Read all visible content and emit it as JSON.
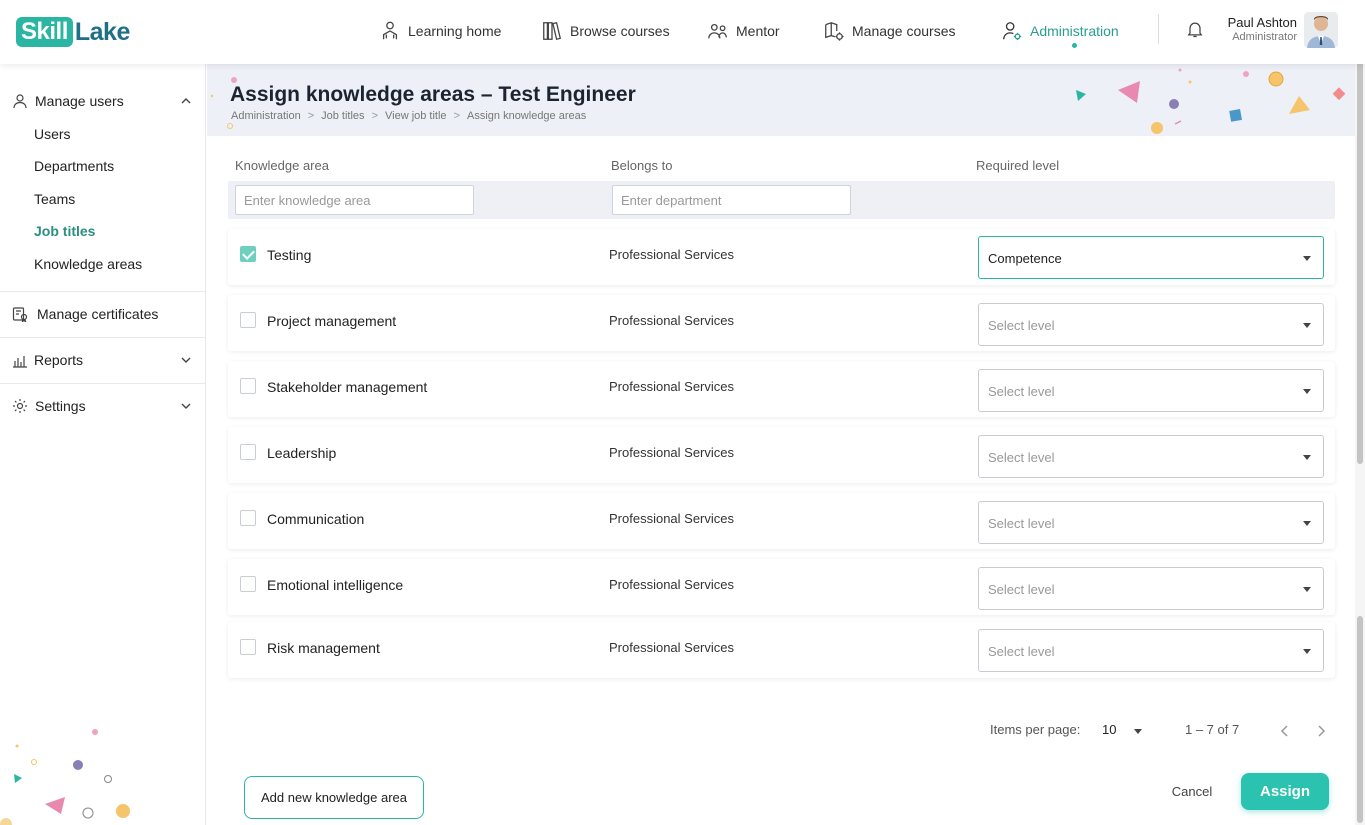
{
  "brand": {
    "part1": "Skill",
    "part2": "Lake"
  },
  "nav": [
    {
      "label": "Learning home",
      "icon": "learning-home-icon"
    },
    {
      "label": "Browse courses",
      "icon": "books-icon"
    },
    {
      "label": "Mentor",
      "icon": "mentor-icon"
    },
    {
      "label": "Manage courses",
      "icon": "manage-courses-icon"
    },
    {
      "label": "Administration",
      "icon": "administration-icon",
      "active": true
    }
  ],
  "user": {
    "name": "Paul Ashton",
    "role": "Administrator"
  },
  "sidebar": {
    "manage_users": "Manage users",
    "sub_items": [
      "Users",
      "Departments",
      "Teams",
      "Job titles",
      "Knowledge areas"
    ],
    "active_sub": "Job titles",
    "manage_certificates": "Manage certificates",
    "reports": "Reports",
    "settings": "Settings"
  },
  "page": {
    "title": "Assign knowledge areas – Test Engineer",
    "breadcrumb": [
      "Administration",
      "Job titles",
      "View job title",
      "Assign knowledge areas"
    ]
  },
  "table": {
    "columns": [
      "Knowledge area",
      "Belongs to",
      "Required level"
    ],
    "filters": {
      "knowledge_placeholder": "Enter knowledge area",
      "department_placeholder": "Enter department"
    },
    "rows": [
      {
        "name": "Testing",
        "dept": "Professional Services",
        "level": "Competence",
        "checked": true
      },
      {
        "name": "Project management",
        "dept": "Professional Services",
        "level": "Select level",
        "checked": false
      },
      {
        "name": "Stakeholder management",
        "dept": "Professional Services",
        "level": "Select level",
        "checked": false
      },
      {
        "name": "Leadership",
        "dept": "Professional Services",
        "level": "Select level",
        "checked": false
      },
      {
        "name": "Communication",
        "dept": "Professional Services",
        "level": "Select level",
        "checked": false
      },
      {
        "name": "Emotional intelligence",
        "dept": "Professional Services",
        "level": "Select level",
        "checked": false
      },
      {
        "name": "Risk management",
        "dept": "Professional Services",
        "level": "Select level",
        "checked": false
      }
    ]
  },
  "pagination": {
    "label": "Items per page:",
    "size": "10",
    "range": "1 – 7 of 7"
  },
  "actions": {
    "add": "Add new knowledge area",
    "cancel": "Cancel",
    "assign": "Assign"
  },
  "colors": {
    "accent": "#2bb5a3",
    "band": "#eef0f7"
  }
}
